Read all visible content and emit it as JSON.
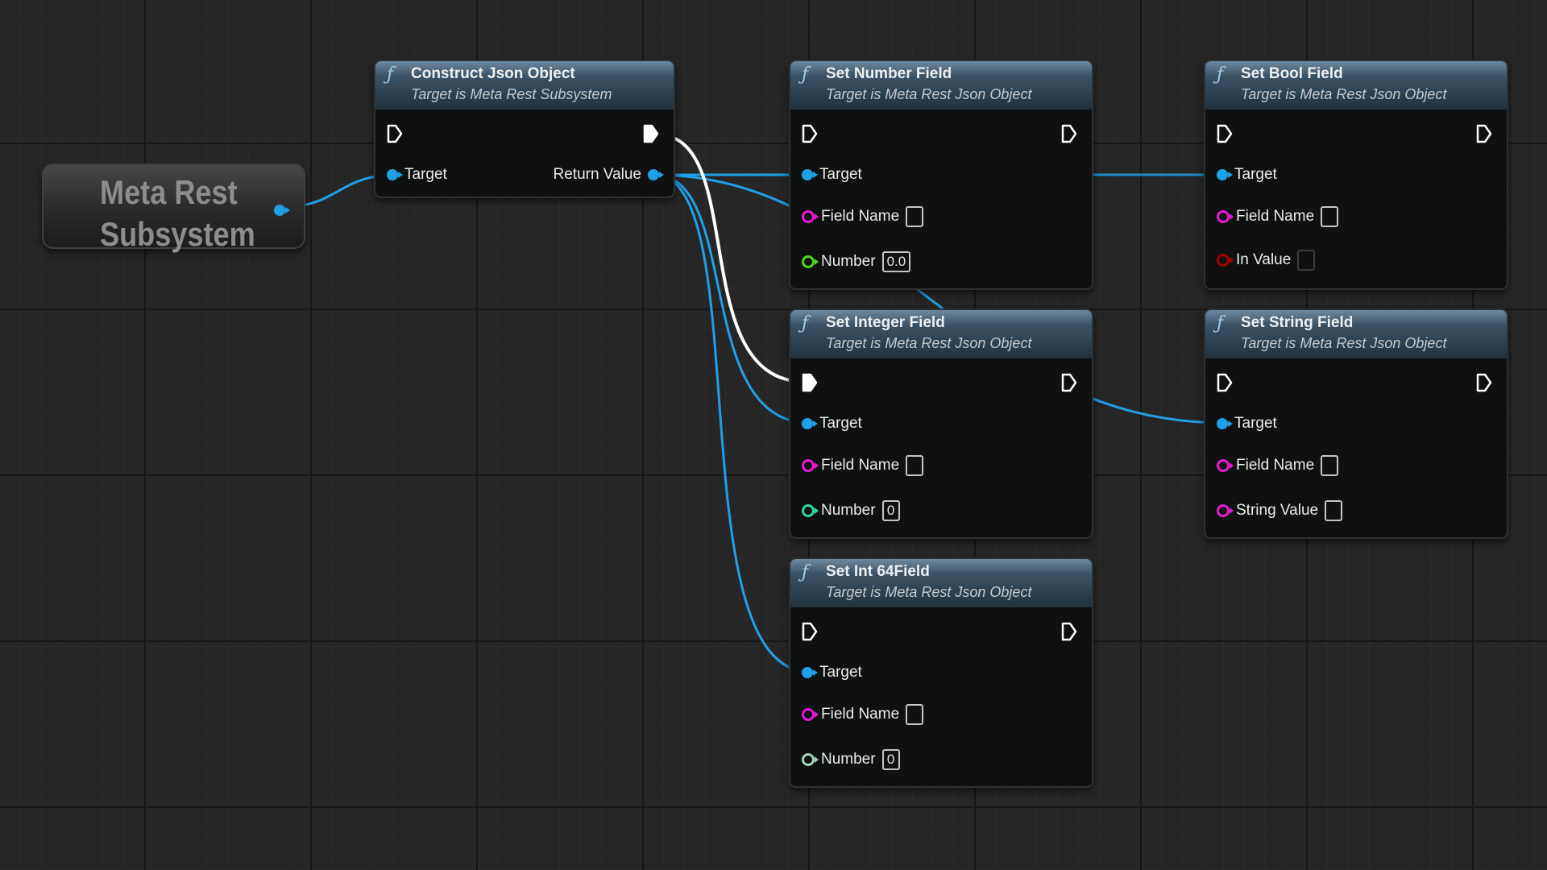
{
  "variable_node": {
    "title": "Meta Rest Subsystem"
  },
  "nodes": {
    "construct": {
      "title": "Construct Json Object",
      "subtitle": "Target is Meta Rest Subsystem",
      "pin_target": "Target",
      "pin_return": "Return Value"
    },
    "set_number": {
      "title": "Set Number Field",
      "subtitle": "Target is Meta Rest Json Object",
      "pin_target": "Target",
      "pin_field_name": "Field Name",
      "pin_value_label": "Number",
      "pin_value": "0.0"
    },
    "set_bool": {
      "title": "Set Bool Field",
      "subtitle": "Target is Meta Rest Json Object",
      "pin_target": "Target",
      "pin_field_name": "Field Name",
      "pin_value_label": "In Value"
    },
    "set_integer": {
      "title": "Set Integer Field",
      "subtitle": "Target is Meta Rest Json Object",
      "pin_target": "Target",
      "pin_field_name": "Field Name",
      "pin_value_label": "Number",
      "pin_value": "0"
    },
    "set_string": {
      "title": "Set String Field",
      "subtitle": "Target is Meta Rest Json Object",
      "pin_target": "Target",
      "pin_field_name": "Field Name",
      "pin_value_label": "String Value"
    },
    "set_int64": {
      "title": "Set Int 64Field",
      "subtitle": "Target is Meta Rest Json Object",
      "pin_target": "Target",
      "pin_field_name": "Field Name",
      "pin_value_label": "Number",
      "pin_value": "0"
    }
  },
  "colors": {
    "graph_background": "#262626",
    "node_header": "#3c5366",
    "object_pin": "#1fa0e8",
    "string_pin": "#e31ad6",
    "float_pin": "#4ed420",
    "integer_pin": "#2ed6a0",
    "int64_pin": "#9ad3b8",
    "bool_pin": "#a50000",
    "exec_wire": "#ffffff"
  },
  "icons": {
    "function": "function-icon",
    "exec_in": "exec-in-pin-icon",
    "exec_out": "exec-out-pin-icon",
    "object_pin": "object-pin-icon"
  }
}
